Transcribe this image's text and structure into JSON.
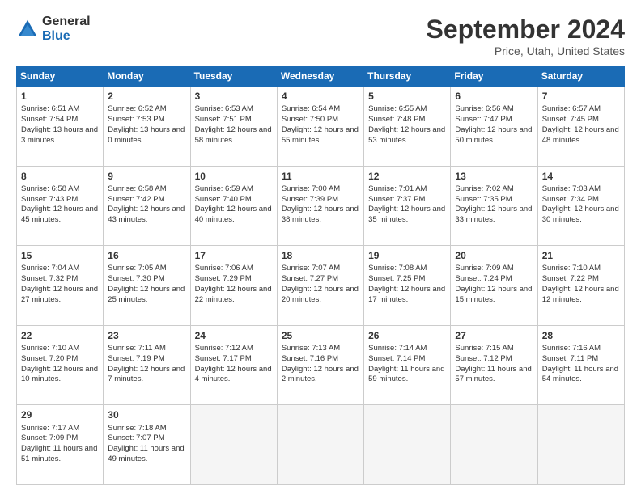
{
  "logo": {
    "general": "General",
    "blue": "Blue"
  },
  "title": "September 2024",
  "location": "Price, Utah, United States",
  "days": [
    "Sunday",
    "Monday",
    "Tuesday",
    "Wednesday",
    "Thursday",
    "Friday",
    "Saturday"
  ],
  "weeks": [
    [
      {
        "num": "1",
        "rise": "6:51 AM",
        "set": "7:54 PM",
        "daylight": "13 hours and 3 minutes."
      },
      {
        "num": "2",
        "rise": "6:52 AM",
        "set": "7:53 PM",
        "daylight": "13 hours and 0 minutes."
      },
      {
        "num": "3",
        "rise": "6:53 AM",
        "set": "7:51 PM",
        "daylight": "12 hours and 58 minutes."
      },
      {
        "num": "4",
        "rise": "6:54 AM",
        "set": "7:50 PM",
        "daylight": "12 hours and 55 minutes."
      },
      {
        "num": "5",
        "rise": "6:55 AM",
        "set": "7:48 PM",
        "daylight": "12 hours and 53 minutes."
      },
      {
        "num": "6",
        "rise": "6:56 AM",
        "set": "7:47 PM",
        "daylight": "12 hours and 50 minutes."
      },
      {
        "num": "7",
        "rise": "6:57 AM",
        "set": "7:45 PM",
        "daylight": "12 hours and 48 minutes."
      }
    ],
    [
      {
        "num": "8",
        "rise": "6:58 AM",
        "set": "7:43 PM",
        "daylight": "12 hours and 45 minutes."
      },
      {
        "num": "9",
        "rise": "6:58 AM",
        "set": "7:42 PM",
        "daylight": "12 hours and 43 minutes."
      },
      {
        "num": "10",
        "rise": "6:59 AM",
        "set": "7:40 PM",
        "daylight": "12 hours and 40 minutes."
      },
      {
        "num": "11",
        "rise": "7:00 AM",
        "set": "7:39 PM",
        "daylight": "12 hours and 38 minutes."
      },
      {
        "num": "12",
        "rise": "7:01 AM",
        "set": "7:37 PM",
        "daylight": "12 hours and 35 minutes."
      },
      {
        "num": "13",
        "rise": "7:02 AM",
        "set": "7:35 PM",
        "daylight": "12 hours and 33 minutes."
      },
      {
        "num": "14",
        "rise": "7:03 AM",
        "set": "7:34 PM",
        "daylight": "12 hours and 30 minutes."
      }
    ],
    [
      {
        "num": "15",
        "rise": "7:04 AM",
        "set": "7:32 PM",
        "daylight": "12 hours and 27 minutes."
      },
      {
        "num": "16",
        "rise": "7:05 AM",
        "set": "7:30 PM",
        "daylight": "12 hours and 25 minutes."
      },
      {
        "num": "17",
        "rise": "7:06 AM",
        "set": "7:29 PM",
        "daylight": "12 hours and 22 minutes."
      },
      {
        "num": "18",
        "rise": "7:07 AM",
        "set": "7:27 PM",
        "daylight": "12 hours and 20 minutes."
      },
      {
        "num": "19",
        "rise": "7:08 AM",
        "set": "7:25 PM",
        "daylight": "12 hours and 17 minutes."
      },
      {
        "num": "20",
        "rise": "7:09 AM",
        "set": "7:24 PM",
        "daylight": "12 hours and 15 minutes."
      },
      {
        "num": "21",
        "rise": "7:10 AM",
        "set": "7:22 PM",
        "daylight": "12 hours and 12 minutes."
      }
    ],
    [
      {
        "num": "22",
        "rise": "7:10 AM",
        "set": "7:20 PM",
        "daylight": "12 hours and 10 minutes."
      },
      {
        "num": "23",
        "rise": "7:11 AM",
        "set": "7:19 PM",
        "daylight": "12 hours and 7 minutes."
      },
      {
        "num": "24",
        "rise": "7:12 AM",
        "set": "7:17 PM",
        "daylight": "12 hours and 4 minutes."
      },
      {
        "num": "25",
        "rise": "7:13 AM",
        "set": "7:16 PM",
        "daylight": "12 hours and 2 minutes."
      },
      {
        "num": "26",
        "rise": "7:14 AM",
        "set": "7:14 PM",
        "daylight": "11 hours and 59 minutes."
      },
      {
        "num": "27",
        "rise": "7:15 AM",
        "set": "7:12 PM",
        "daylight": "11 hours and 57 minutes."
      },
      {
        "num": "28",
        "rise": "7:16 AM",
        "set": "7:11 PM",
        "daylight": "11 hours and 54 minutes."
      }
    ],
    [
      {
        "num": "29",
        "rise": "7:17 AM",
        "set": "7:09 PM",
        "daylight": "11 hours and 51 minutes."
      },
      {
        "num": "30",
        "rise": "7:18 AM",
        "set": "7:07 PM",
        "daylight": "11 hours and 49 minutes."
      },
      null,
      null,
      null,
      null,
      null
    ]
  ]
}
